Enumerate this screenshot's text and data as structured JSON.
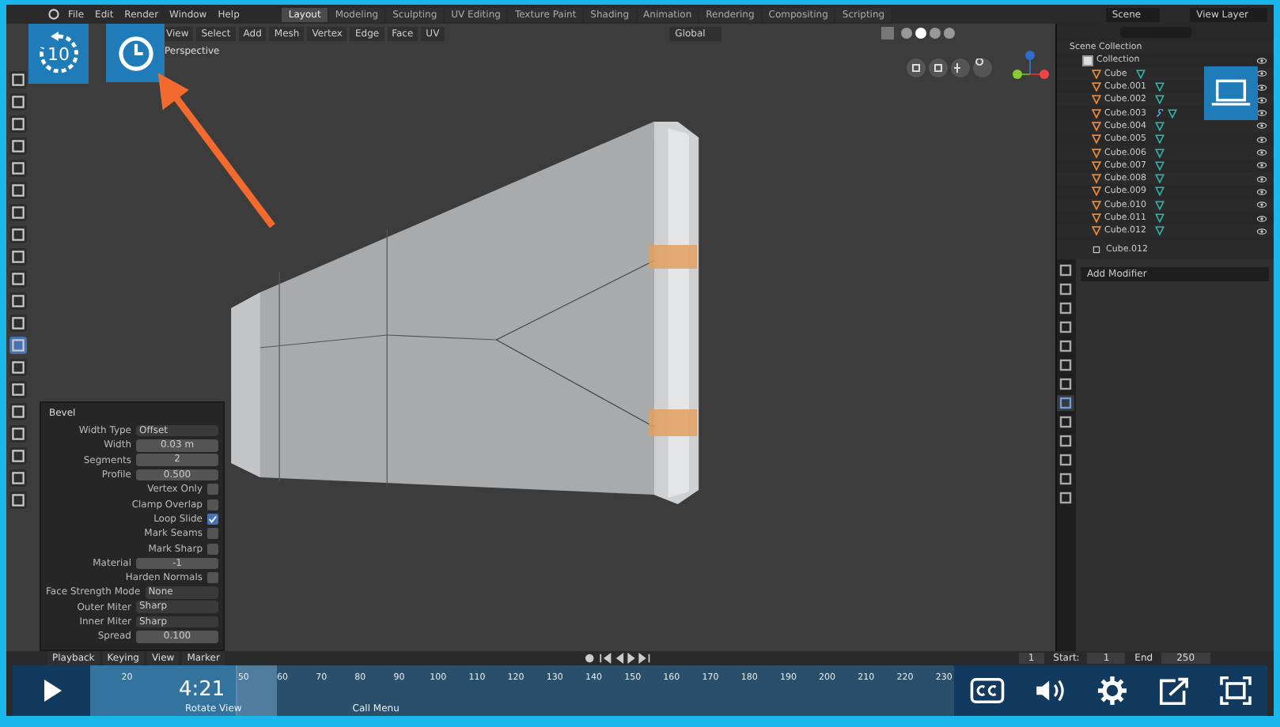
{
  "blender": {
    "menu": [
      "File",
      "Edit",
      "Render",
      "Window",
      "Help"
    ],
    "workspaces": [
      {
        "label": "Layout",
        "selected": true
      },
      {
        "label": "Modeling",
        "selected": false
      },
      {
        "label": "Sculpting",
        "selected": false
      },
      {
        "label": "UV Editing",
        "selected": false
      },
      {
        "label": "Texture Paint",
        "selected": false
      },
      {
        "label": "Shading",
        "selected": false
      },
      {
        "label": "Animation",
        "selected": false
      },
      {
        "label": "Rendering",
        "selected": false
      },
      {
        "label": "Compositing",
        "selected": false
      },
      {
        "label": "Scripting",
        "selected": false
      }
    ],
    "scene": "Scene",
    "view_layer": "View Layer",
    "viewport_menu": [
      "View",
      "Select",
      "Add",
      "Mesh",
      "Vertex",
      "Edge",
      "Face",
      "UV"
    ],
    "orientation": "Global",
    "viewport_label": "Perspective",
    "tools": [
      {
        "selected": false
      },
      {
        "selected": false
      },
      {
        "selected": false
      },
      {
        "selected": false
      },
      {
        "selected": false
      },
      {
        "selected": false
      },
      {
        "selected": false
      },
      {
        "selected": false
      },
      {
        "selected": false
      },
      {
        "selected": false
      },
      {
        "selected": false
      },
      {
        "selected": false
      },
      {
        "selected": true
      },
      {
        "selected": false
      },
      {
        "selected": false
      },
      {
        "selected": false
      },
      {
        "selected": false
      },
      {
        "selected": false
      },
      {
        "selected": false
      },
      {
        "selected": false
      }
    ],
    "bevel": {
      "title": "Bevel",
      "rows": [
        {
          "kind": "dropdown",
          "label": "Width Type",
          "value": "Offset"
        },
        {
          "kind": "number",
          "label": "Width",
          "value": "0.03 m"
        },
        {
          "kind": "number",
          "label": "Segments",
          "value": "2"
        },
        {
          "kind": "number",
          "label": "Profile",
          "value": "0.500"
        },
        {
          "kind": "checkbox",
          "label": "Vertex Only",
          "checked": false
        },
        {
          "kind": "checkbox",
          "label": "Clamp Overlap",
          "checked": false
        },
        {
          "kind": "checkbox",
          "label": "Loop Slide",
          "checked": true
        },
        {
          "kind": "checkbox",
          "label": "Mark Seams",
          "checked": false
        },
        {
          "kind": "checkbox",
          "label": "Mark Sharp",
          "checked": false
        },
        {
          "kind": "number",
          "label": "Material",
          "value": "-1"
        },
        {
          "kind": "checkbox",
          "label": "Harden Normals",
          "checked": false
        },
        {
          "kind": "dropdown",
          "label": "Face Strength Mode",
          "value": "None"
        },
        {
          "kind": "dropdown",
          "label": "Outer Miter",
          "value": "Sharp"
        },
        {
          "kind": "dropdown",
          "label": "Inner Miter",
          "value": "Sharp"
        },
        {
          "kind": "number",
          "label": "Spread",
          "value": "0.100"
        }
      ]
    },
    "outliner": {
      "root": "Scene Collection",
      "collection": {
        "label": "Collection",
        "checked": true
      },
      "objects": [
        {
          "name": "Cube",
          "modifier": false
        },
        {
          "name": "Cube.001",
          "modifier": false
        },
        {
          "name": "Cube.002",
          "modifier": false
        },
        {
          "name": "Cube.003",
          "modifier": true
        },
        {
          "name": "Cube.004",
          "modifier": false
        },
        {
          "name": "Cube.005",
          "modifier": false
        },
        {
          "name": "Cube.006",
          "modifier": false
        },
        {
          "name": "Cube.007",
          "modifier": false
        },
        {
          "name": "Cube.008",
          "modifier": false
        },
        {
          "name": "Cube.009",
          "modifier": false
        },
        {
          "name": "Cube.010",
          "modifier": false
        },
        {
          "name": "Cube.011",
          "modifier": false
        },
        {
          "name": "Cube.012",
          "modifier": false
        }
      ]
    },
    "properties": {
      "object": "Cube.012",
      "add_modifier": "Add Modifier",
      "tabs": [
        {
          "selected": false
        },
        {
          "selected": false
        },
        {
          "selected": false
        },
        {
          "selected": false
        },
        {
          "selected": false
        },
        {
          "selected": false
        },
        {
          "selected": false
        },
        {
          "selected": true
        },
        {
          "selected": false
        },
        {
          "selected": false
        },
        {
          "selected": false
        },
        {
          "selected": false
        },
        {
          "selected": false
        }
      ]
    },
    "timeline": {
      "menu": [
        "Playback",
        "Keying",
        "View",
        "Marker"
      ],
      "frame": "1",
      "start_label": "Start:",
      "start": "1",
      "end_label": "End",
      "end": "250",
      "ticks": [
        "20",
        "50",
        "60",
        "70",
        "80",
        "90",
        "100",
        "110",
        "120",
        "130",
        "140",
        "150",
        "160",
        "170",
        "180",
        "190",
        "200",
        "210",
        "220",
        "230"
      ]
    },
    "status_bar": [
      "Rotate View",
      "Call Menu"
    ]
  },
  "player": {
    "rewind_label": "10",
    "time": "4:21",
    "progress": {
      "level": 0.17
    }
  }
}
